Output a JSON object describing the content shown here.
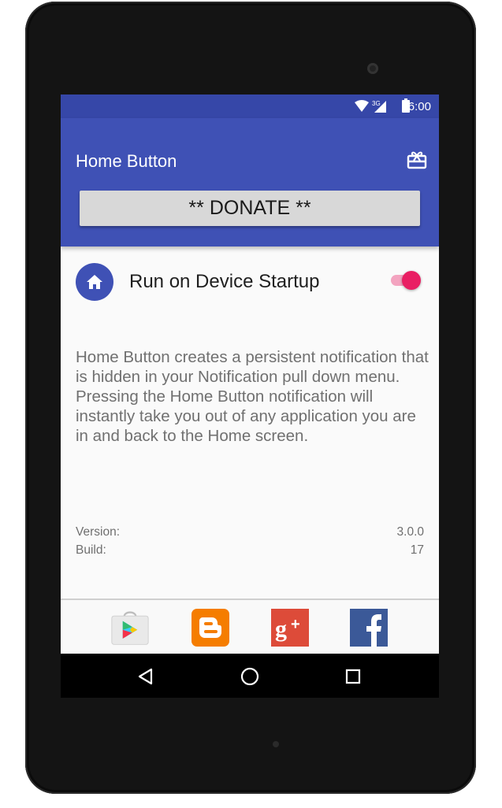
{
  "status_bar": {
    "time": "6:00",
    "network": "3G",
    "icons": [
      "wifi-icon",
      "cell-signal-icon",
      "battery-icon"
    ]
  },
  "app_bar": {
    "title": "Home Button",
    "action_icon": "gift-card-icon"
  },
  "donate_button": {
    "label": "** DONATE **"
  },
  "startup_setting": {
    "icon": "home-icon",
    "label": "Run on Device Startup",
    "enabled": true
  },
  "description": "Home Button creates a persistent notification that is hidden in your Notification pull down menu. Pressing the Home Button notification will instantly take you out of any application you are in and back to the Home screen.",
  "info": {
    "version_label": "Version:",
    "version_value": "3.0.0",
    "build_label": "Build:",
    "build_value": "17"
  },
  "app_links": [
    {
      "icon": "google-play-icon"
    },
    {
      "icon": "blogger-icon"
    },
    {
      "icon": "google-plus-icon"
    },
    {
      "icon": "facebook-icon"
    }
  ],
  "nav_bar": {
    "icons": [
      "back-icon",
      "home-nav-icon",
      "recents-icon"
    ]
  },
  "colors": {
    "primary": "#3f51b5",
    "primary_dark": "#3647a8",
    "accent": "#e91e63",
    "blogger": "#f57d00",
    "google_plus": "#dd4b39",
    "facebook": "#3b5998"
  }
}
